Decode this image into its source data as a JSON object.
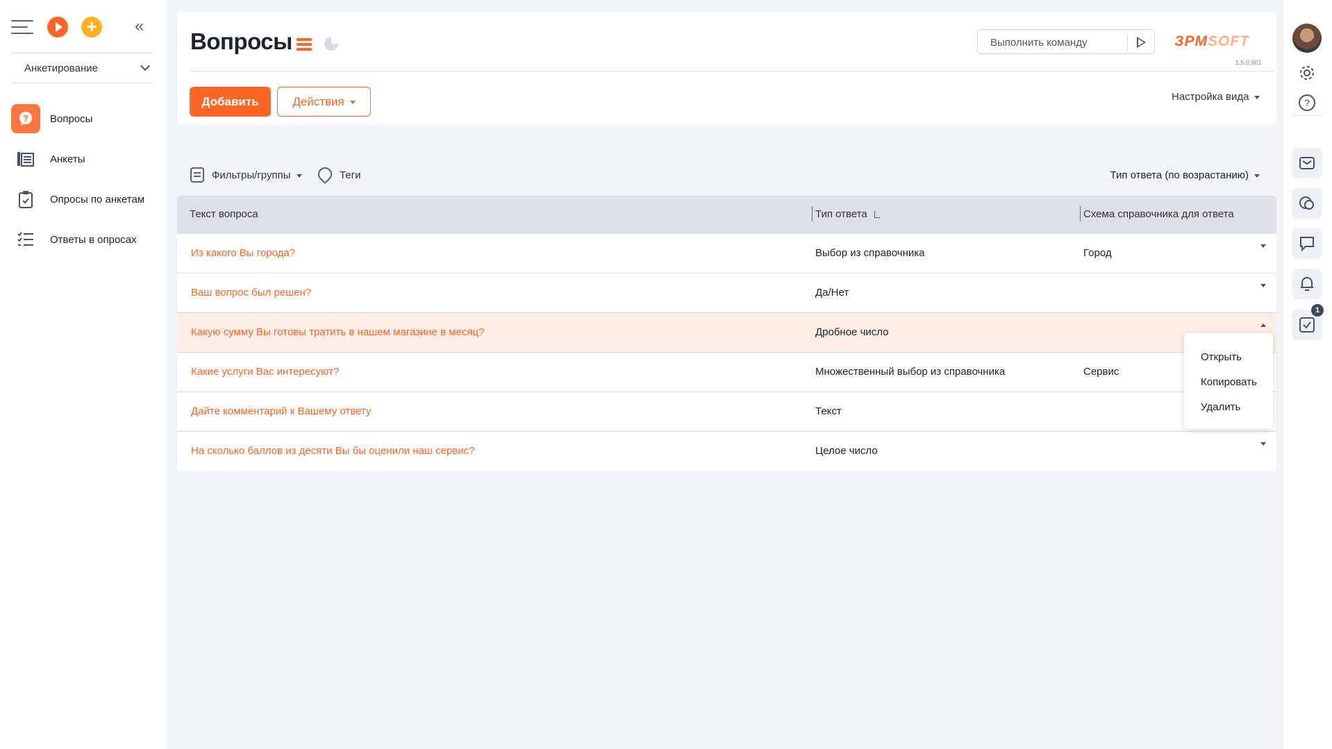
{
  "sidebar": {
    "workspace": "Анкетирование",
    "items": [
      {
        "label": "Вопросы"
      },
      {
        "label": "Анкеты"
      },
      {
        "label": "Опросы по анкетам"
      },
      {
        "label": "Ответы в опросах"
      }
    ]
  },
  "header": {
    "title": "Вопросы",
    "command_placeholder": "Выполнить команду",
    "logo_main": "ЗPM",
    "logo_soft": "SOFT",
    "version": "1.5.0.901",
    "add_label": "Добавить",
    "actions_label": "Действия",
    "view_settings_label": "Настройка вида"
  },
  "filters": {
    "filters_label": "Фильтры/группы",
    "tags_label": "Теги",
    "sort_label": "Тип ответа (по возрастанию)"
  },
  "grid": {
    "columns": [
      "Текст вопроса",
      "Тип ответа",
      "Схема справочника для ответа"
    ],
    "rows": [
      [
        "Из какого Вы города?",
        "Выбор из справочника",
        "Город"
      ],
      [
        "Ваш вопрос был решен?",
        "Да/Нет",
        ""
      ],
      [
        "Какую сумму Вы готовы тратить в нашем магазине в месяц?",
        "Дробное число",
        ""
      ],
      [
        "Какие услуги Вас интересуют?",
        "Множественный выбор из справочника",
        "Сервис"
      ],
      [
        "Дайте комментарий к Вашему ответу",
        "Текст",
        ""
      ],
      [
        "На сколько баллов из десяти Вы бы оценили наш сервис?",
        "Целое число",
        ""
      ]
    ]
  },
  "context_menu": [
    "Открыть",
    "Копировать",
    "Удалить"
  ],
  "rightbar": {
    "tasks_badge": "1"
  },
  "colors": {
    "accent": "#ff6524",
    "highlight_row": "#ffeee6",
    "header_bg": "#dee0e6"
  }
}
